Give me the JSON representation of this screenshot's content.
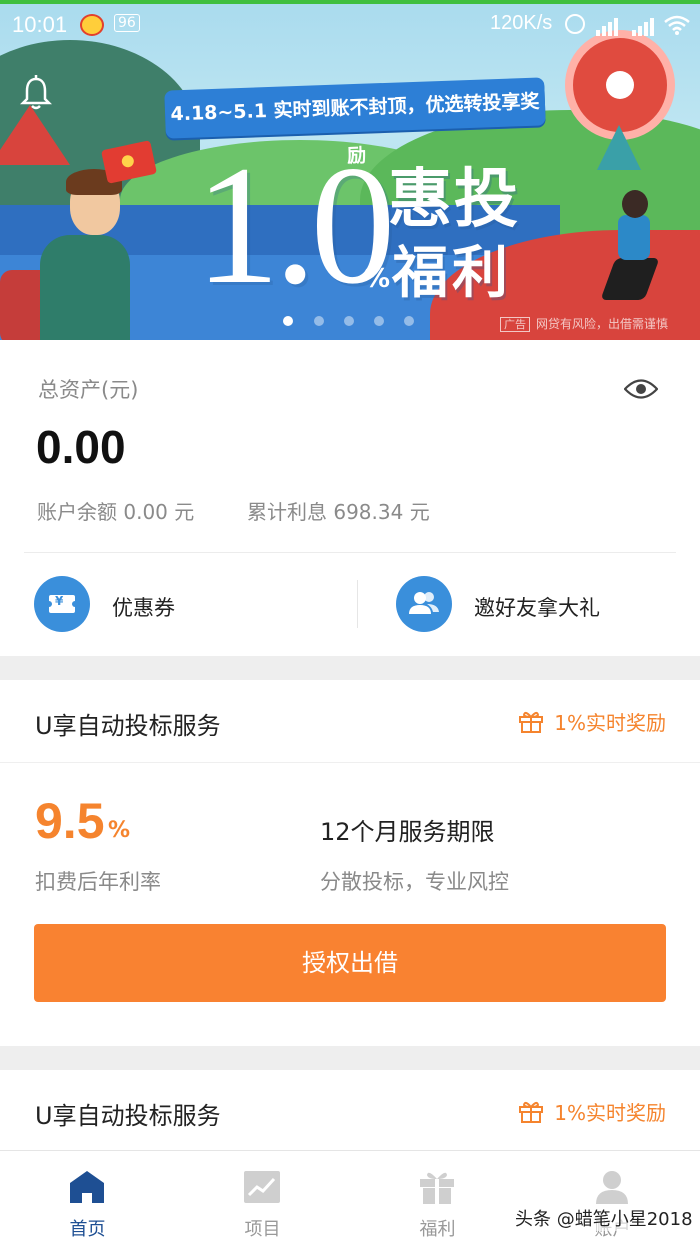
{
  "status_bar": {
    "time": "10:01",
    "notification_badge": "96",
    "net_speed": "120K/s"
  },
  "banner": {
    "promo_text": "4.18~5.1 实时到账不封顶，优选转投享奖励",
    "big_number": "1.0",
    "percent_sign": "%",
    "headline_line1": "惠投",
    "headline_line2": "福利",
    "ad_tag": "广告",
    "disclaimer": "网贷有风险，出借需谨慎",
    "page_count": 5,
    "active_page": 1
  },
  "assets": {
    "label": "总资产(元)",
    "amount": "0.00",
    "balance_label": "账户余额 0.00 元",
    "interest_label": "累计利息 698.34 元",
    "coupon_label": "优惠券",
    "invite_label": "邀好友拿大礼",
    "coupon_icon_symbol": "¥"
  },
  "services": [
    {
      "title": "U享自动投标服务",
      "reward": "1%实时奖励",
      "rate_value": "9.5",
      "rate_unit": "%",
      "rate_label": "扣费后年利率",
      "term": "12个月服务期限",
      "term_desc": "分散投标，专业风控",
      "button_label": "授权出借"
    },
    {
      "title": "U享自动投标服务",
      "reward": "1%实时奖励"
    }
  ],
  "tabbar": {
    "items": [
      {
        "label": "首页",
        "icon": "home-icon",
        "active": true
      },
      {
        "label": "项目",
        "icon": "chart-icon",
        "active": false
      },
      {
        "label": "福利",
        "icon": "gift-icon",
        "active": false
      },
      {
        "label": "账户",
        "icon": "user-icon",
        "active": false
      }
    ]
  },
  "watermark": "头条 @蜡笔小星2018",
  "colors": {
    "accent_orange": "#f98231",
    "reward_orange": "#f5842e",
    "icon_blue": "#3a8fdb",
    "tab_active": "#1e4f93"
  }
}
